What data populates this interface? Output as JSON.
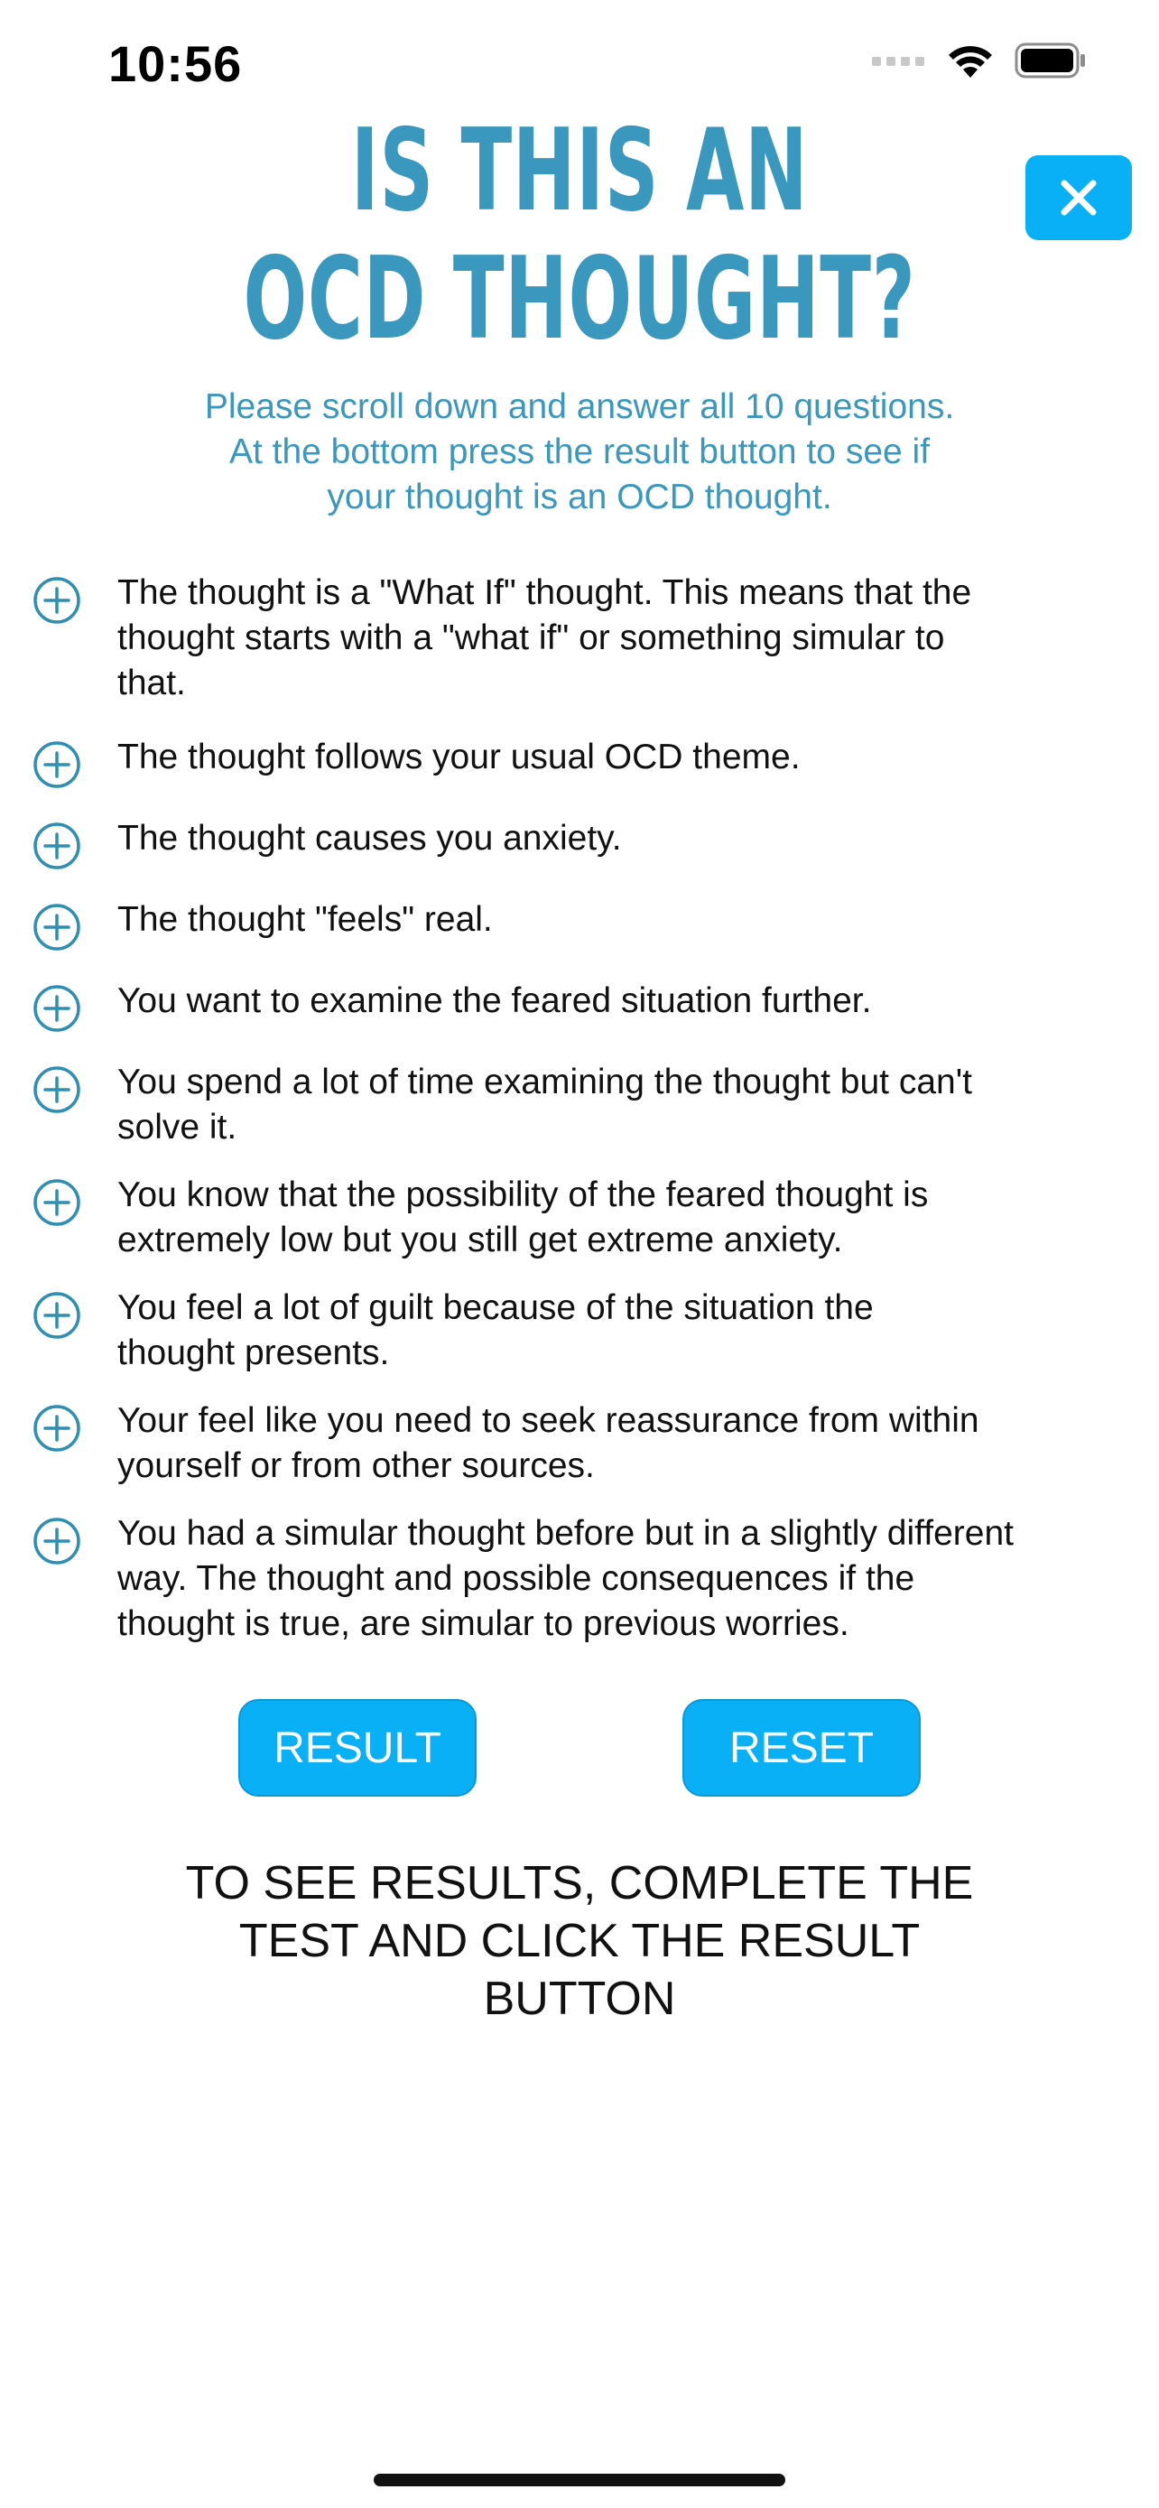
{
  "status_bar": {
    "time": "10:56"
  },
  "header": {
    "title_line1": "IS THIS AN",
    "title_line2": "OCD THOUGHT?",
    "subtitle_line1": "Please scroll down and answer all 10 questions.",
    "subtitle_line2": "At the bottom press the result button to see if",
    "subtitle_line3": "your thought is an OCD thought."
  },
  "questions": [
    {
      "lines": [
        "The thought is a \"What If\" thought. This means that the",
        "thought starts with a \"what if\" or something simular to",
        "that."
      ]
    },
    {
      "lines": [
        "The thought follows your usual OCD theme."
      ]
    },
    {
      "lines": [
        "The thought causes you anxiety."
      ]
    },
    {
      "lines": [
        "The thought \"feels\" real."
      ]
    },
    {
      "lines": [
        "You want to examine the feared situation further."
      ]
    },
    {
      "lines": [
        "You spend a lot of time examining the thought but can't",
        "solve it."
      ]
    },
    {
      "lines": [
        "You know that the possibility of the feared thought is",
        "extremely low but you still get extreme anxiety."
      ]
    },
    {
      "lines": [
        "You feel a lot of guilt because of the situation the",
        "thought presents."
      ]
    },
    {
      "lines": [
        "Your feel like you need to seek reassurance from within",
        "yourself or from other sources."
      ]
    },
    {
      "lines": [
        "You had a simular thought before but in a slightly different",
        "way. The thought and possible consequences if the",
        "thought is true, are simular to previous worries."
      ]
    }
  ],
  "buttons": {
    "result_label": "RESULT",
    "reset_label": "RESET"
  },
  "result_message": {
    "line1": "TO SEE RESULTS, COMPLETE THE",
    "line2": "TEST AND CLICK THE RESULT",
    "line3": "BUTTON"
  },
  "icons": {
    "close": "close-icon",
    "toggle": "plus-circle-icon",
    "signal": "cellular-signal-icon",
    "wifi": "wifi-icon",
    "battery": "battery-icon"
  },
  "colors": {
    "accent_blue": "#0ab0f5",
    "title_teal": "#3a97bd",
    "toggle_teal": "#2f8fb3"
  }
}
